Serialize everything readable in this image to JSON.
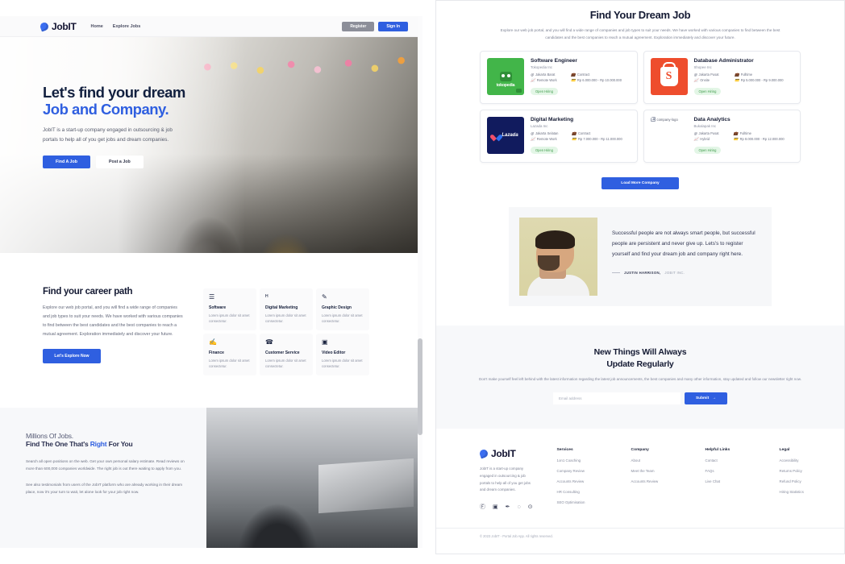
{
  "left": {
    "navbar": {
      "brand": "JobIT",
      "links": [
        {
          "label": "Home"
        },
        {
          "label": "Explore Jobs"
        }
      ],
      "register_label": "Register",
      "signin_label": "Sign In"
    },
    "hero": {
      "title_line1": "Let's find your dream",
      "title_line2": "Job and Company.",
      "paragraph": "JobIT is a start-up company engaged in outsourcing & job portals to help all of you get jobs and dream companies.",
      "primary_button": "Find A Job",
      "secondary_button": "Post a Job"
    },
    "career": {
      "heading": "Find your career path",
      "paragraph": "Explore our web job portal, and you will find a wide range of companies and job types to suit your needs. We have worked with various companies to find between the best candidates and the best companies to reach a mutual agreement. Exploration immediately and discover your future.",
      "button": "Let's Explore Now",
      "categories": [
        {
          "icon": "☰",
          "title": "Software",
          "desc": "Lorem ipsum dolor sit amet consectetur."
        },
        {
          "icon": "ᴴ",
          "title": "Digital Marketing",
          "desc": "Lorem ipsum dolor sit amet consectetur."
        },
        {
          "icon": "✎",
          "title": "Graphic Design",
          "desc": "Lorem ipsum dolor sit amet consectetur."
        },
        {
          "icon": "✍",
          "title": "Finance",
          "desc": "Lorem ipsum dolor sit amet consectetur."
        },
        {
          "icon": "☎",
          "title": "Customer Service",
          "desc": "Lorem ipsum dolor sit amet consectetur."
        },
        {
          "icon": "▣",
          "title": "Video Editor",
          "desc": "Lorem ipsum dolor sit amet consectetur."
        }
      ]
    },
    "millions": {
      "line1": "Millions Of Jobs.",
      "line2_a": "Find The One That's ",
      "line2_accent": "Right",
      "line2_b": " For You",
      "paragraph1": "Search all open positions on the web. Get your own personal salary estimate. Read reviews on more than 600,000 companies worldwide. The right job is out there waiting to apply from you.",
      "paragraph2": "See also testimonials from users of the JobIT platform who are already working in their dream place, now it's your turn to wait, let alone look for your job right now."
    }
  },
  "right": {
    "header": {
      "title": "Find Your Dream Job",
      "subtitle": "Explore our web job portal, and you will find a wide range of companies and job types to suit your needs. We have worked with various companies to find between the best candidates and the best companies to reach a mutual agreement. Exploration immediately and discover your future."
    },
    "jobs": [
      {
        "title": "Software Engineer",
        "company": "Tokopedia Inc",
        "location": "Jakarta Barat",
        "type": "Contract",
        "work_mode": "Remote Work",
        "salary": "Rp 6.000.000 - Rp 10.000.000",
        "status": "Open Hiring",
        "logo": "tokopedia-logo",
        "logo_text": "tokopedia"
      },
      {
        "title": "Database Administrator",
        "company": "Shopee Inc",
        "location": "Jakarta Pusat",
        "type": "Fulltime",
        "work_mode": "Onsite",
        "salary": "Rp 5.000.000 - Rp 9.000.000",
        "status": "Open Hiring",
        "logo": "shopee-logo",
        "logo_text": "S"
      },
      {
        "title": "Digital Marketing",
        "company": "Lazada Inc",
        "location": "Jakarta Selatan",
        "type": "Contract",
        "work_mode": "Remote Work",
        "salary": "Rp 7.000.000 - Rp 11.000.000",
        "status": "Open Hiring",
        "logo": "lazada-logo",
        "logo_text": "Lazada"
      },
      {
        "title": "Data Analytics",
        "company": "Bukalapak Inc",
        "location": "Jakarta Pusat",
        "type": "Fulltime",
        "work_mode": "Hybrid",
        "salary": "Rp 8.000.000 - Rp 12.000.000",
        "status": "Open Hiring",
        "logo": "broken-image-placeholder",
        "logo_text": "company-logo"
      }
    ],
    "meta_icons": {
      "location": "◎",
      "type": "ὋC",
      "work_mode": "▂",
      "salary": "▤"
    },
    "load_more_label": "Load More Company",
    "testimonial": {
      "quote": "Successful people are not always smart people, but successful people are persistent and never give up. Lets's to register yourself and find your dream job and company right here.",
      "author": "JUSTIN HARRISON,",
      "role": "JOBIT INC."
    },
    "newsletter": {
      "title_line1": "New Things Will Always",
      "title_line2": "Update Regularly",
      "subtitle": "Don't make yourself feel left behind with the latest information regarding the latest job announcements, the best companies and many other information, stay updated and follow our newsletter right now.",
      "input_placeholder": "Email address",
      "submit_label": "Submit",
      "submit_arrow": "→"
    },
    "footer": {
      "brand": "JobIT",
      "description": "JobIT is a start-up company engaged in outsourcing & job portals to help all of you get jobs and dream companies.",
      "social": [
        {
          "name": "facebook-icon",
          "glyph": "Ⓕ"
        },
        {
          "name": "instagram-icon",
          "glyph": "▣"
        },
        {
          "name": "twitter-icon",
          "glyph": "✒"
        },
        {
          "name": "github-icon",
          "glyph": "◌"
        },
        {
          "name": "dribbble-icon",
          "glyph": "⊙"
        }
      ],
      "columns": [
        {
          "title": "Services",
          "items": [
            "1on1 Coaching",
            "Company Review",
            "Accounts Review",
            "HR Consulting",
            "SEO Optimisation"
          ]
        },
        {
          "title": "Company",
          "items": [
            "About",
            "Meet the Team",
            "Accounts Review"
          ]
        },
        {
          "title": "Helpful Links",
          "items": [
            "Contact",
            "FAQs",
            "Live Chat"
          ]
        },
        {
          "title": "Legal",
          "items": [
            "Accessibility",
            "Returns Policy",
            "Refund Policy",
            "Hiring Statistics"
          ]
        }
      ],
      "copyright": "© 2023 JobIT - Portal Job App. All rights reserved."
    }
  },
  "colors": {
    "primary": "#2f5fe0",
    "dark": "#141a33",
    "muted": "#7d8294",
    "success": "#3f9b4b",
    "tokopedia": "#42b549",
    "shopee": "#ee4d2d",
    "lazada": "#111b5e"
  }
}
